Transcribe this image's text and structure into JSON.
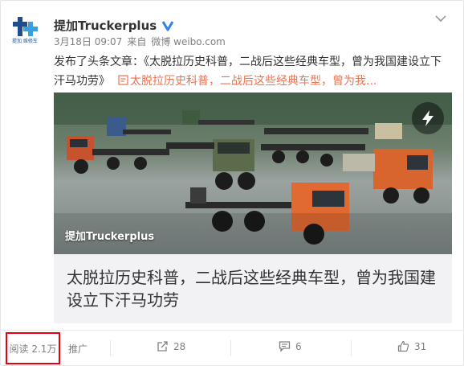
{
  "post": {
    "author": "提加Truckerplus",
    "logo_caption": "提加 维修车",
    "timestamp": "3月18日 09:07",
    "source_prefix": "来自",
    "source": "微博 weibo.com",
    "text_prefix": "发布了头条文章：《太脱拉历史科普，二战后这些经典车型，曾为我国建设立下汗马功劳》",
    "link_text": "太脱拉历史科普，二战后这些经典车型，曾为我...",
    "image_watermark": "提加Truckerplus",
    "article_title": "太脱拉历史科普，二战后这些经典车型，曾为我国建设立下汗马功劳"
  },
  "actions": {
    "reads": "阅读 2.1万",
    "promote": "推广",
    "forward_count": "28",
    "comment_count": "6",
    "like_count": "31"
  },
  "colors": {
    "accent": "#eb7350",
    "highlight_border": "#e60012",
    "verified": "#2b82f0",
    "logo": "#1f4d8f"
  }
}
